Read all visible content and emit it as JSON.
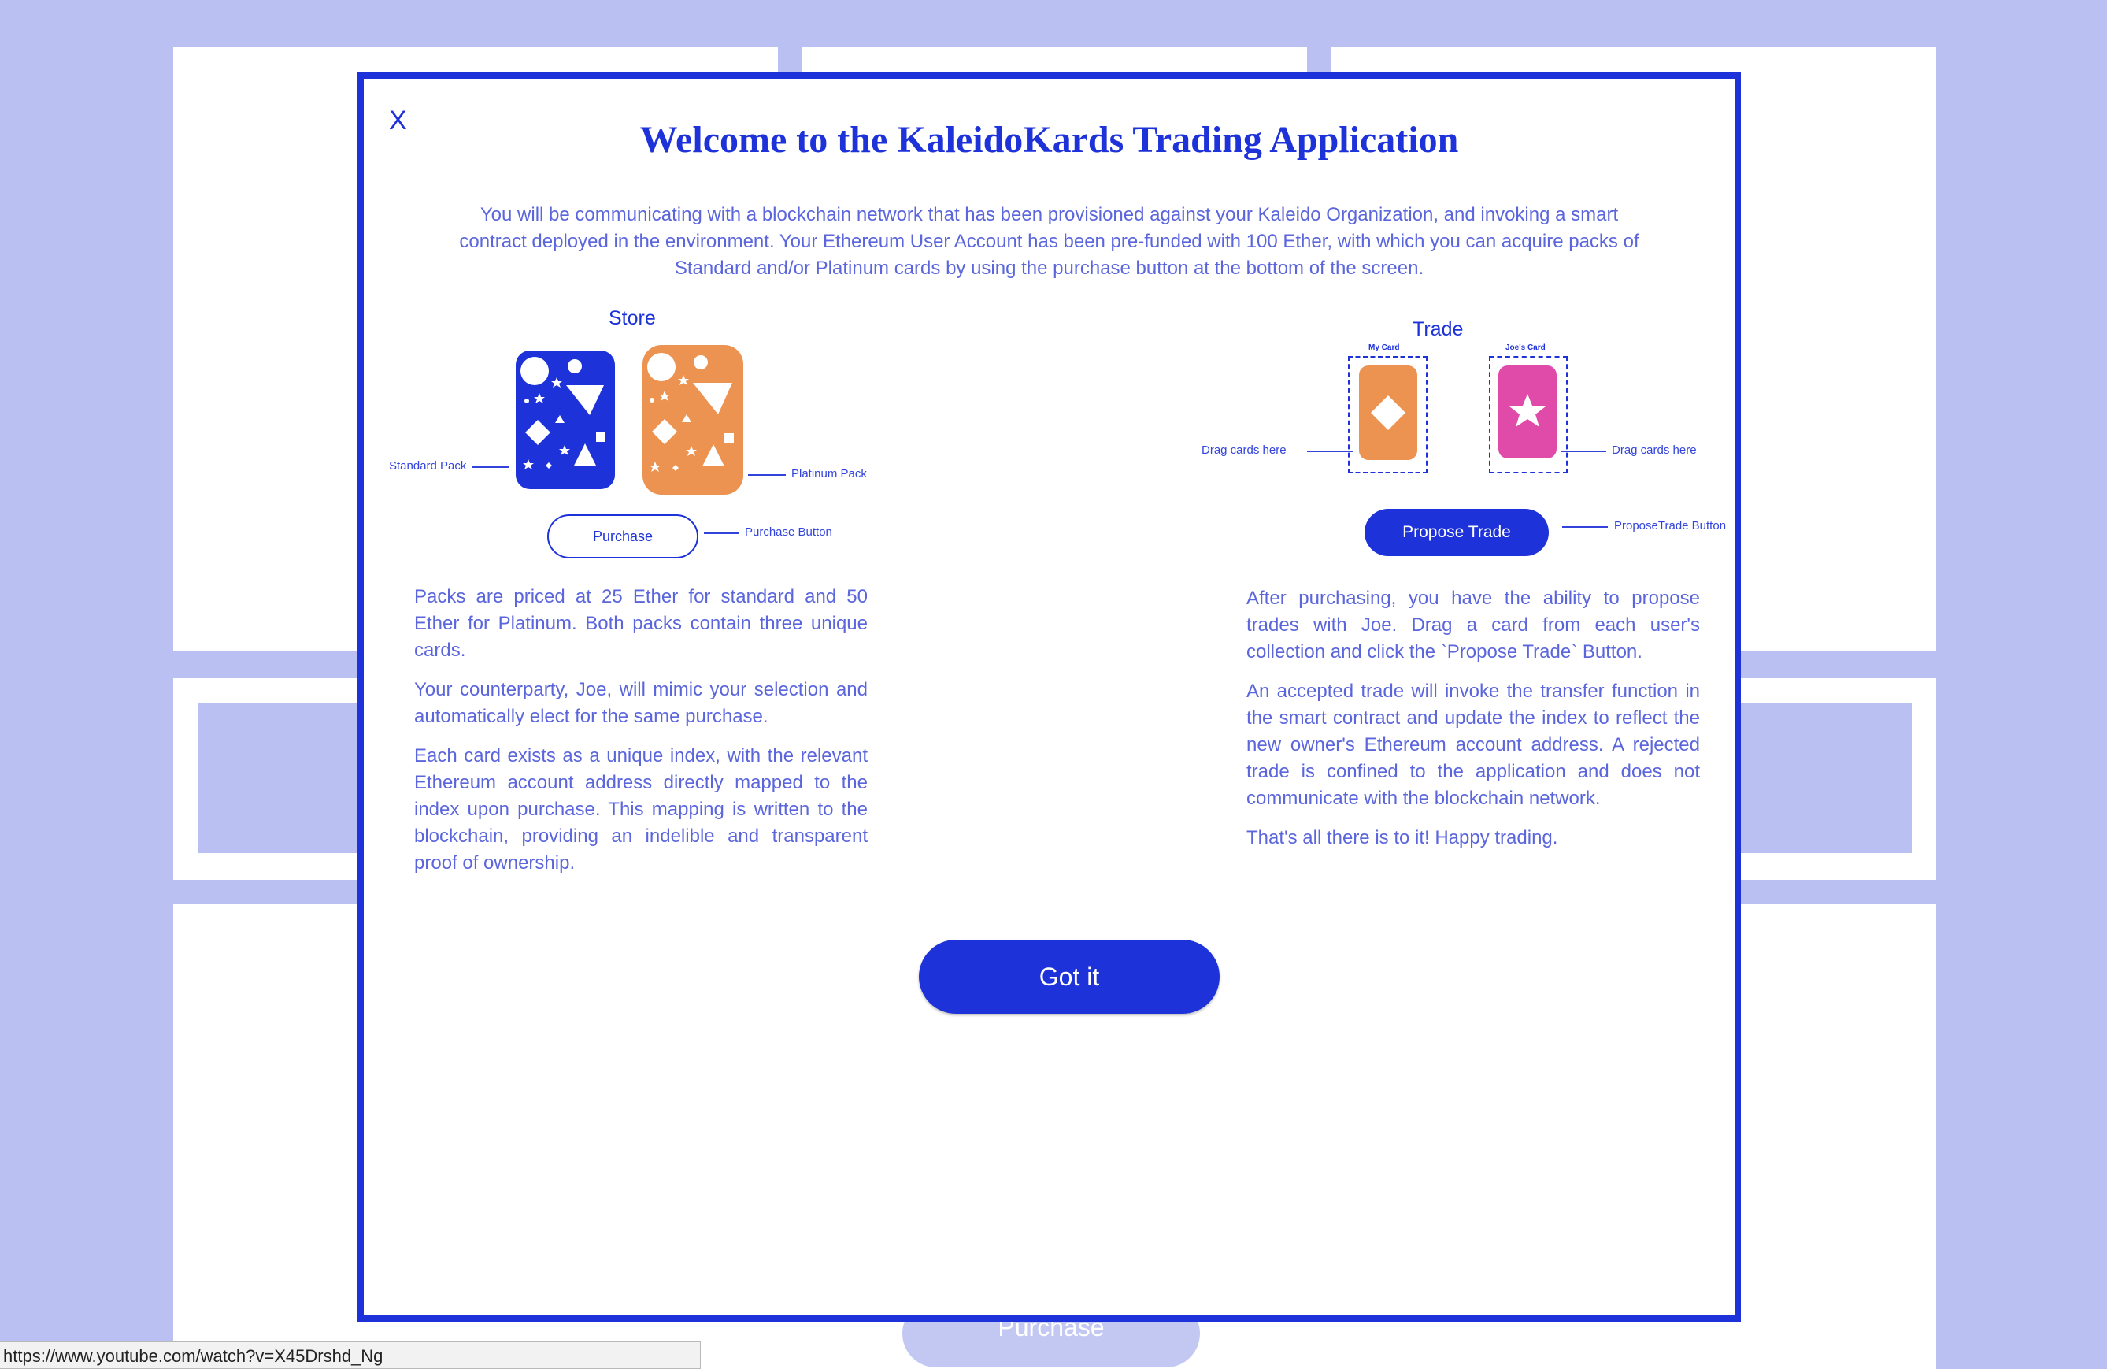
{
  "background": {
    "purchase_label": "Purchase",
    "status_url": "https://www.youtube.com/watch?v=X45Drshd_Ng"
  },
  "modal": {
    "close_label": "X",
    "title": "Welcome to the KaleidoKards Trading Application",
    "intro": "You will be communicating with a blockchain network that has been provisioned against your Kaleido Organization, and invoking a smart contract deployed in the environment. Your Ethereum User Account has been pre-funded with 100 Ether, with which you can acquire packs of Standard and/or Platinum cards by using the purchase button at the bottom of the screen.",
    "store": {
      "title": "Store",
      "standard_label": "Standard Pack",
      "platinum_label": "Platinum Pack",
      "purchase_label": "Purchase",
      "purchase_button_label": "Purchase Button"
    },
    "trade": {
      "title": "Trade",
      "my_card_label": "My Card",
      "joes_card_label": "Joe's Card",
      "drag_left_label": "Drag cards here",
      "drag_right_label": "Drag cards here",
      "propose_label": "Propose Trade",
      "propose_button_label": "ProposeTrade Button"
    },
    "left_paragraphs": [
      "Packs are priced at 25 Ether for standard and 50 Ether for Platinum. Both packs contain three unique cards.",
      "Your counterparty, Joe, will mimic your selection and automatically elect for the same purchase.",
      "Each card exists as a unique index, with the relevant Ethereum account address directly mapped to the index upon purchase. This mapping is written to the blockchain, providing an indelible and transparent proof of ownership."
    ],
    "right_paragraphs": [
      "After purchasing, you have the ability to propose trades with Joe. Drag a card from each user's collection and click the `Propose Trade` Button.",
      "An accepted trade will invoke the transfer function in the smart contract and update the index to reflect the new owner's Ethereum account address. A rejected trade is confined to the application and does not communicate with the blockchain network.",
      "That's all there is to it! Happy trading."
    ],
    "got_it_label": "Got it"
  },
  "colors": {
    "accent": "#1e32d9",
    "text": "#5b66dc",
    "background": "#bac0f1",
    "standard_pack": "#1e32d9",
    "platinum_pack": "#ec9352",
    "joes_card": "#e04aa8"
  }
}
